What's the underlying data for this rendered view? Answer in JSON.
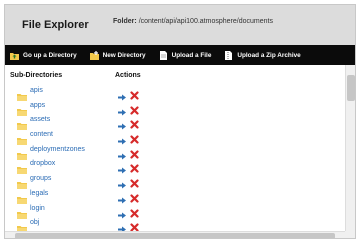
{
  "header": {
    "title": "File Explorer",
    "folder_label": "Folder:",
    "folder_path": "/content/api/api100.atmosphere/documents"
  },
  "toolbar": {
    "items": [
      {
        "label": "Go up a Directory",
        "icon": "folder-up-icon"
      },
      {
        "label": "New Directory",
        "icon": "new-folder-icon"
      },
      {
        "label": "Upload a File",
        "icon": "upload-file-icon"
      },
      {
        "label": "Upload a Zip Archive",
        "icon": "upload-zip-icon"
      }
    ]
  },
  "table": {
    "col_subdirs": "Sub-Directories",
    "col_actions": "Actions",
    "rows": [
      {
        "name": "apis"
      },
      {
        "name": "apps"
      },
      {
        "name": "assets"
      },
      {
        "name": "content"
      },
      {
        "name": "deploymentzones"
      },
      {
        "name": "dropbox"
      },
      {
        "name": "groups"
      },
      {
        "name": "legals"
      },
      {
        "name": "login"
      },
      {
        "name": "obj"
      }
    ]
  },
  "colors": {
    "header_bg": "#dcdcdc",
    "toolbar_bg": "#0b0b0b",
    "link": "#2b6cb5",
    "folder": "#f2c94c",
    "delete": "#d62a2a"
  }
}
